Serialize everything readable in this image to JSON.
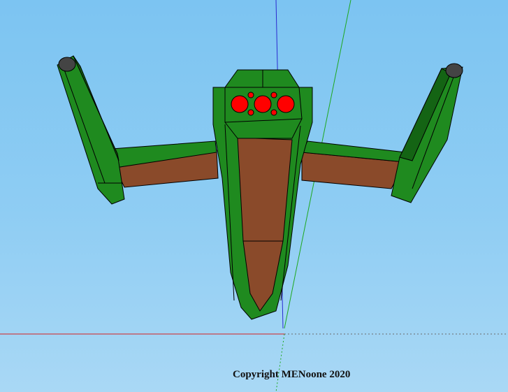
{
  "viewport": {
    "background_top": "#7cc4f2",
    "background_bottom": "#a9d8f5"
  },
  "axes": {
    "x_axis_color": "#d62020",
    "y_axis_color": "#1ea81e",
    "z_axis_color": "#2a2ad0"
  },
  "model": {
    "hull_color": "#1f8a1f",
    "hull_dark_color": "#146414",
    "wood_color": "#8a4a2a",
    "light_color": "#ff0000",
    "nacelle_cap_color": "#444444"
  },
  "watermark": {
    "text": "Copyright MENoone 2020"
  }
}
